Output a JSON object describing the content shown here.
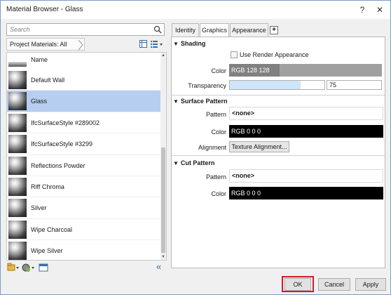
{
  "window": {
    "title": "Material Browser - Glass",
    "help_glyph": "?",
    "close_glyph": "✕"
  },
  "browser": {
    "search_placeholder": "Search",
    "filter_label": "Project Materials: All",
    "column_header": "Name",
    "materials": [
      {
        "label": "Default Wall",
        "selected": false
      },
      {
        "label": "Glass",
        "selected": true
      },
      {
        "label": "IfcSurfaceStyle #289002",
        "selected": false
      },
      {
        "label": "IfcSurfaceStyle #3299",
        "selected": false
      },
      {
        "label": "Reflections Powder",
        "selected": false
      },
      {
        "label": "Riff Chroma",
        "selected": false
      },
      {
        "label": "Silver",
        "selected": false
      },
      {
        "label": "Wipe Charcoal",
        "selected": false
      },
      {
        "label": "Wipe Silver",
        "selected": false
      }
    ],
    "collapse_glyph": "«"
  },
  "tabs": [
    {
      "label": "Identity",
      "active": false
    },
    {
      "label": "Graphics",
      "active": true
    },
    {
      "label": "Appearance",
      "active": false
    }
  ],
  "tab_add_glyph": "+",
  "graphics": {
    "shading": {
      "title": "Shading",
      "use_render_label": "Use Render Appearance",
      "use_render_checked": false,
      "color_label": "Color",
      "color_value": "RGB 128 128 128",
      "color_hex": "#808080",
      "transparency_label": "Transparency",
      "transparency_value": "75",
      "transparency_fraction": 0.75
    },
    "surface_pattern": {
      "title": "Surface Pattern",
      "pattern_label": "Pattern",
      "pattern_value": "<none>",
      "color_label": "Color",
      "color_value": "RGB 0 0 0",
      "color_hex": "#000000",
      "alignment_label": "Alignment",
      "alignment_button": "Texture Alignment..."
    },
    "cut_pattern": {
      "title": "Cut Pattern",
      "pattern_label": "Pattern",
      "pattern_value": "<none>",
      "color_label": "Color",
      "color_value": "RGB 0 0 0",
      "color_hex": "#000000"
    }
  },
  "footer": {
    "ok": "OK",
    "cancel": "Cancel",
    "apply": "Apply"
  },
  "colors": {
    "selected_row": "#b6cef0",
    "highlight": "#d11a2a"
  }
}
